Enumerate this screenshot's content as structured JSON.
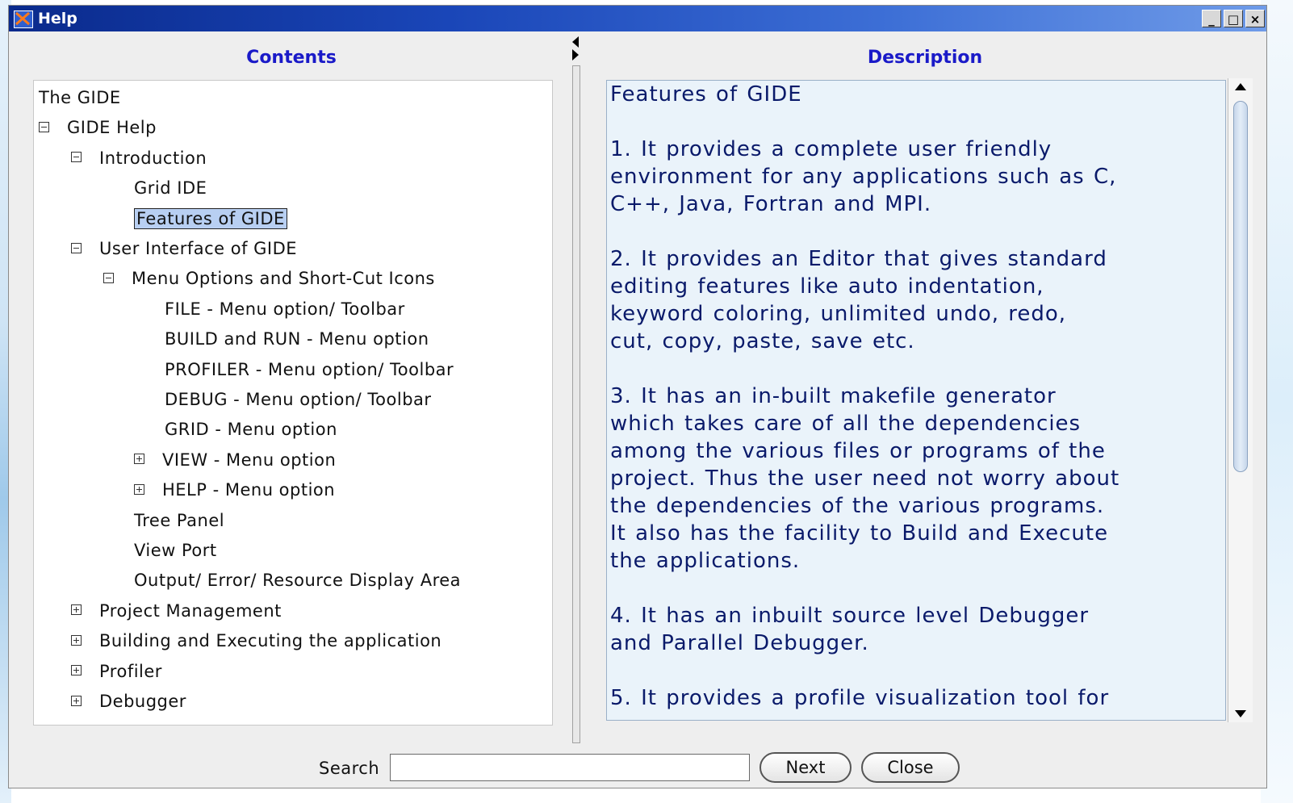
{
  "window": {
    "title": "Help",
    "controls": [
      "_",
      "□",
      "×"
    ]
  },
  "contents": {
    "header": "Contents",
    "tree": [
      {
        "label": "The GIDE",
        "level": 0,
        "toggle": "none"
      },
      {
        "label": "GIDE Help",
        "level": 0,
        "toggle": "minus"
      },
      {
        "label": "Introduction",
        "level": 1,
        "toggle": "minus"
      },
      {
        "label": "Grid IDE",
        "level": 2,
        "toggle": "none"
      },
      {
        "label": "Features of GIDE",
        "level": 2,
        "toggle": "none",
        "selected": true
      },
      {
        "label": "User Interface of GIDE",
        "level": 1,
        "toggle": "minus"
      },
      {
        "label": "Menu Options and Short-Cut Icons",
        "level": 2,
        "toggle": "minus"
      },
      {
        "label": "FILE - Menu option/ Toolbar",
        "level": 3,
        "toggle": "none"
      },
      {
        "label": "BUILD and RUN - Menu option",
        "level": 3,
        "toggle": "none"
      },
      {
        "label": "PROFILER - Menu option/ Toolbar",
        "level": 3,
        "toggle": "none"
      },
      {
        "label": "DEBUG - Menu option/ Toolbar",
        "level": 3,
        "toggle": "none"
      },
      {
        "label": "GRID - Menu option",
        "level": 3,
        "toggle": "none"
      },
      {
        "label": "VIEW - Menu option",
        "level": 3,
        "toggle": "plus"
      },
      {
        "label": "HELP - Menu option",
        "level": 3,
        "toggle": "plus"
      },
      {
        "label": "Tree Panel",
        "level": 2,
        "toggle": "none"
      },
      {
        "label": "View Port",
        "level": 2,
        "toggle": "none"
      },
      {
        "label": "Output/ Error/ Resource Display Area",
        "level": 2,
        "toggle": "none"
      },
      {
        "label": "Project Management",
        "level": 1,
        "toggle": "plus"
      },
      {
        "label": "Building and Executing the application",
        "level": 1,
        "toggle": "plus"
      },
      {
        "label": "Profiler",
        "level": 1,
        "toggle": "plus"
      },
      {
        "label": "Debugger",
        "level": 1,
        "toggle": "plus"
      }
    ]
  },
  "description": {
    "header": "Description",
    "lines": [
      "Features of GIDE",
      "",
      "1. It provides a complete user friendly",
      "environment for any applications such as C,",
      "C++, Java, Fortran and MPI.",
      "",
      "2. It provides an Editor that gives standard",
      "editing features like auto indentation,",
      "keyword coloring, unlimited undo, redo,",
      "cut, copy, paste, save etc.",
      "",
      "3. It has an in-built makefile generator",
      "which takes care of all the dependencies",
      "among the various files or programs of the",
      "project. Thus the user need  not worry about",
      "the dependencies of the various  programs.",
      "It also has the facility to Build and Execute",
      "the applications.",
      "",
      "4. It has an inbuilt source level Debugger",
      "and Parallel Debugger.",
      "",
      "5. It provides a profile visualization tool for"
    ]
  },
  "search": {
    "label": "Search",
    "value": "",
    "next_label": "Next",
    "close_label": "Close"
  }
}
